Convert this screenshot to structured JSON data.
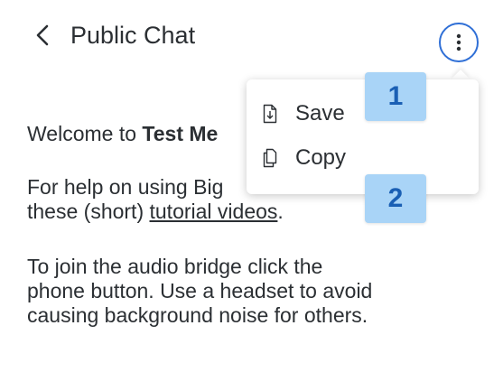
{
  "header": {
    "title": "Public Chat",
    "back_icon": "chevron-left-icon",
    "more_icon": "more-vertical-icon"
  },
  "chat": {
    "welcome_prefix": "Welcome to ",
    "welcome_bold": "Test Me",
    "help_line1": "For help on using Big",
    "help_line2_prefix": "these (short) ",
    "help_link": "tutorial videos",
    "help_line2_suffix": ".",
    "audio_line1": "To join the audio bridge click the",
    "audio_line2": "phone button. Use a headset to avoid",
    "audio_line3": "causing background noise for others."
  },
  "menu": {
    "items": [
      {
        "label": "Save",
        "icon": "download-file-icon"
      },
      {
        "label": "Copy",
        "icon": "copy-icon"
      }
    ]
  },
  "callouts": {
    "one": "1",
    "two": "2",
    "color": "#a9d4f7"
  },
  "colors": {
    "accent": "#2f6fd6",
    "text": "#2b2f33"
  }
}
